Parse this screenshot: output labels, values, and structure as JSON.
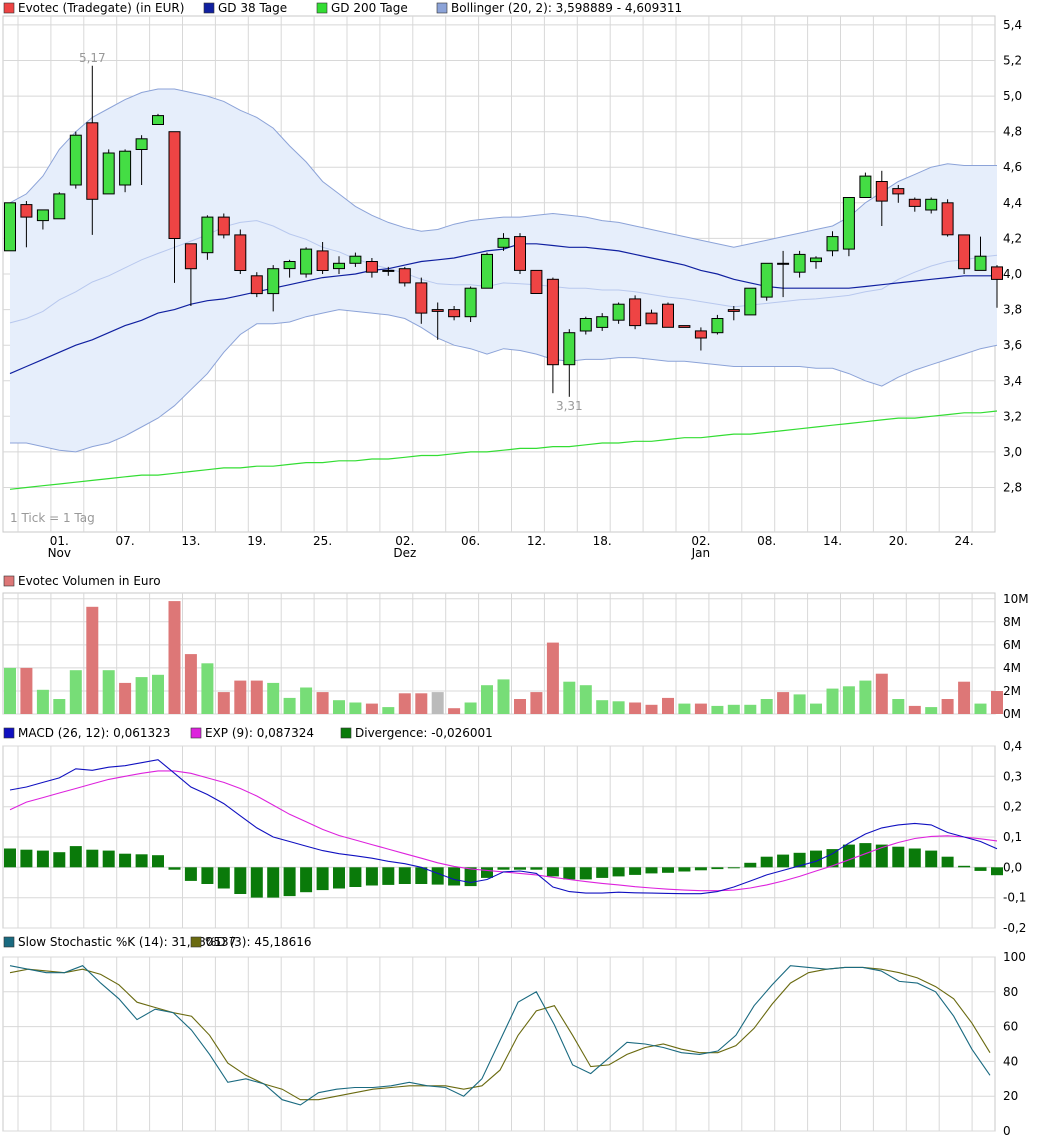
{
  "colors": {
    "up": "#44dd44",
    "down": "#ee4444",
    "neutral": "#bbbbbb",
    "gd38": "#1020a0",
    "gd200": "#33dd33",
    "bollinger": "#8ca3d8",
    "bollinger_fill": "#e6eefb",
    "vol_up": "#77dd77",
    "vol_down": "#dd7777",
    "macd": "#1010c0",
    "exp": "#dd22dd",
    "divergence": "#0a7a0a",
    "stoch_k": "#1a6a80",
    "stoch_d": "#6a6a10",
    "grid": "#d8d8d8",
    "label_grey": "#999999"
  },
  "chart_data": [
    {
      "type": "candlestick",
      "legend": [
        {
          "label": "Evotec (Tradegate) (in EUR)",
          "color": "#ee4444"
        },
        {
          "label": "GD 38 Tage",
          "color": "#1020a0"
        },
        {
          "label": "GD 200 Tage",
          "color": "#33dd33"
        },
        {
          "label": "Bollinger (20, 2): 3,598889 - 4,609311",
          "color": "#8ca3d8"
        }
      ],
      "ylim": [
        2.55,
        5.45
      ],
      "yticks": [
        "2,8",
        "3,0",
        "3,2",
        "3,4",
        "3,6",
        "3,8",
        "4,0",
        "4,2",
        "4,4",
        "4,6",
        "4,8",
        "5,0",
        "5,2",
        "5,4"
      ],
      "xticks": [
        {
          "i": 3,
          "label": "01.",
          "sub": "Nov"
        },
        {
          "i": 7,
          "label": "07.",
          "sub": ""
        },
        {
          "i": 11,
          "label": "13.",
          "sub": ""
        },
        {
          "i": 15,
          "label": "19.",
          "sub": ""
        },
        {
          "i": 19,
          "label": "25.",
          "sub": ""
        },
        {
          "i": 24,
          "label": "02.",
          "sub": "Dez"
        },
        {
          "i": 28,
          "label": "06.",
          "sub": ""
        },
        {
          "i": 32,
          "label": "12.",
          "sub": ""
        },
        {
          "i": 36,
          "label": "18.",
          "sub": ""
        },
        {
          "i": 42,
          "label": "02.",
          "sub": "Jan"
        },
        {
          "i": 46,
          "label": "08.",
          "sub": ""
        },
        {
          "i": 50,
          "label": "14.",
          "sub": ""
        },
        {
          "i": 54,
          "label": "20.",
          "sub": ""
        },
        {
          "i": 58,
          "label": "24.",
          "sub": ""
        }
      ],
      "annotations": [
        {
          "i": 5,
          "value": 5.17,
          "text": "5,17",
          "position": "above"
        },
        {
          "i": 34,
          "value": 3.31,
          "text": "3,31",
          "position": "below"
        }
      ],
      "note": "1 Tick = 1 Tag",
      "candles": [
        [
          4.13,
          4.4,
          4.13,
          4.4
        ],
        [
          4.39,
          4.41,
          4.15,
          4.32
        ],
        [
          4.3,
          4.36,
          4.25,
          4.36
        ],
        [
          4.31,
          4.46,
          4.31,
          4.45
        ],
        [
          4.5,
          4.8,
          4.48,
          4.78
        ],
        [
          4.85,
          5.17,
          4.22,
          4.42
        ],
        [
          4.45,
          4.7,
          4.45,
          4.68
        ],
        [
          4.5,
          4.7,
          4.46,
          4.69
        ],
        [
          4.7,
          4.78,
          4.5,
          4.76
        ],
        [
          4.84,
          4.9,
          4.84,
          4.89
        ],
        [
          4.8,
          4.8,
          3.95,
          4.2
        ],
        [
          4.17,
          4.17,
          3.82,
          4.03
        ],
        [
          4.12,
          4.33,
          4.08,
          4.32
        ],
        [
          4.32,
          4.34,
          4.2,
          4.22
        ],
        [
          4.22,
          4.25,
          4.0,
          4.02
        ],
        [
          3.99,
          4.01,
          3.87,
          3.89
        ],
        [
          3.89,
          4.05,
          3.79,
          4.03
        ],
        [
          4.03,
          4.08,
          3.98,
          4.07
        ],
        [
          4.0,
          4.15,
          3.98,
          4.14
        ],
        [
          4.13,
          4.18,
          4.0,
          4.02
        ],
        [
          4.03,
          4.1,
          4.0,
          4.06
        ],
        [
          4.06,
          4.12,
          4.04,
          4.1
        ],
        [
          4.07,
          4.09,
          3.98,
          4.01
        ],
        [
          4.02,
          4.04,
          3.99,
          4.02
        ],
        [
          4.03,
          4.04,
          3.93,
          3.95
        ],
        [
          3.95,
          3.98,
          3.72,
          3.78
        ],
        [
          3.8,
          3.84,
          3.63,
          3.79
        ],
        [
          3.8,
          3.82,
          3.74,
          3.76
        ],
        [
          3.76,
          3.93,
          3.73,
          3.92
        ],
        [
          3.92,
          4.12,
          3.92,
          4.11
        ],
        [
          4.15,
          4.23,
          4.13,
          4.2
        ],
        [
          4.21,
          4.23,
          4.0,
          4.02
        ],
        [
          4.02,
          4.02,
          3.89,
          3.89
        ],
        [
          3.97,
          3.98,
          3.33,
          3.49
        ],
        [
          3.49,
          3.69,
          3.31,
          3.67
        ],
        [
          3.68,
          3.76,
          3.66,
          3.75
        ],
        [
          3.7,
          3.78,
          3.68,
          3.76
        ],
        [
          3.74,
          3.84,
          3.72,
          3.83
        ],
        [
          3.86,
          3.88,
          3.69,
          3.71
        ],
        [
          3.78,
          3.8,
          3.72,
          3.72
        ],
        [
          3.83,
          3.84,
          3.7,
          3.7
        ],
        [
          3.71,
          3.71,
          3.7,
          3.7
        ],
        [
          3.68,
          3.7,
          3.57,
          3.64
        ],
        [
          3.67,
          3.77,
          3.66,
          3.75
        ],
        [
          3.8,
          3.82,
          3.74,
          3.79
        ],
        [
          3.77,
          3.92,
          3.77,
          3.92
        ],
        [
          3.87,
          4.06,
          3.85,
          4.06
        ],
        [
          4.06,
          4.13,
          3.87,
          4.06
        ],
        [
          4.01,
          4.13,
          3.98,
          4.11
        ],
        [
          4.07,
          4.1,
          4.03,
          4.09
        ],
        [
          4.13,
          4.24,
          4.1,
          4.21
        ],
        [
          4.14,
          4.43,
          4.1,
          4.43
        ],
        [
          4.43,
          4.57,
          4.43,
          4.55
        ],
        [
          4.52,
          4.58,
          4.27,
          4.41
        ],
        [
          4.48,
          4.5,
          4.4,
          4.45
        ],
        [
          4.42,
          4.43,
          4.35,
          4.38
        ],
        [
          4.36,
          4.43,
          4.34,
          4.42
        ],
        [
          4.4,
          4.42,
          4.21,
          4.22
        ],
        [
          4.22,
          4.22,
          4.0,
          4.03
        ],
        [
          4.02,
          4.21,
          4.02,
          4.1
        ],
        [
          4.04,
          4.05,
          3.81,
          3.97
        ]
      ],
      "gd38": [
        3.44,
        3.48,
        3.52,
        3.56,
        3.6,
        3.63,
        3.67,
        3.71,
        3.74,
        3.78,
        3.8,
        3.83,
        3.85,
        3.86,
        3.88,
        3.9,
        3.92,
        3.94,
        3.96,
        3.98,
        3.99,
        4.0,
        4.02,
        4.03,
        4.05,
        4.07,
        4.08,
        4.09,
        4.11,
        4.13,
        4.14,
        4.17,
        4.17,
        4.16,
        4.15,
        4.15,
        4.14,
        4.13,
        4.11,
        4.09,
        4.07,
        4.05,
        4.02,
        4.0,
        3.97,
        3.95,
        3.93,
        3.92,
        3.92,
        3.92,
        3.92,
        3.92,
        3.93,
        3.94,
        3.95,
        3.96,
        3.97,
        3.98,
        3.99,
        3.99,
        3.99
      ],
      "gd200": [
        2.79,
        2.8,
        2.81,
        2.82,
        2.83,
        2.84,
        2.85,
        2.86,
        2.87,
        2.87,
        2.88,
        2.89,
        2.9,
        2.91,
        2.91,
        2.92,
        2.92,
        2.93,
        2.94,
        2.94,
        2.95,
        2.95,
        2.96,
        2.96,
        2.97,
        2.98,
        2.98,
        2.99,
        3.0,
        3.0,
        3.01,
        3.02,
        3.02,
        3.03,
        3.03,
        3.04,
        3.05,
        3.05,
        3.06,
        3.06,
        3.07,
        3.08,
        3.08,
        3.09,
        3.1,
        3.1,
        3.11,
        3.12,
        3.13,
        3.14,
        3.15,
        3.16,
        3.17,
        3.18,
        3.19,
        3.19,
        3.2,
        3.21,
        3.22,
        3.22,
        3.23
      ],
      "bollinger_upper": [
        4.4,
        4.45,
        4.55,
        4.7,
        4.8,
        4.88,
        4.93,
        4.98,
        5.02,
        5.04,
        5.04,
        5.02,
        5.0,
        4.97,
        4.92,
        4.88,
        4.82,
        4.72,
        4.63,
        4.52,
        4.45,
        4.38,
        4.33,
        4.29,
        4.26,
        4.24,
        4.25,
        4.28,
        4.3,
        4.31,
        4.32,
        4.32,
        4.33,
        4.34,
        4.33,
        4.32,
        4.3,
        4.29,
        4.27,
        4.25,
        4.23,
        4.21,
        4.19,
        4.17,
        4.15,
        4.17,
        4.19,
        4.21,
        4.23,
        4.25,
        4.27,
        4.32,
        4.4,
        4.46,
        4.52,
        4.56,
        4.6,
        4.62,
        4.61,
        4.61,
        4.61
      ],
      "bollinger_lower": [
        3.05,
        3.05,
        3.03,
        3.01,
        3.0,
        3.03,
        3.05,
        3.09,
        3.14,
        3.19,
        3.26,
        3.35,
        3.44,
        3.56,
        3.66,
        3.72,
        3.72,
        3.73,
        3.76,
        3.78,
        3.8,
        3.79,
        3.78,
        3.77,
        3.75,
        3.7,
        3.64,
        3.6,
        3.58,
        3.55,
        3.58,
        3.57,
        3.55,
        3.52,
        3.51,
        3.52,
        3.52,
        3.53,
        3.53,
        3.52,
        3.51,
        3.51,
        3.5,
        3.49,
        3.48,
        3.48,
        3.48,
        3.48,
        3.48,
        3.47,
        3.47,
        3.44,
        3.4,
        3.37,
        3.42,
        3.46,
        3.49,
        3.52,
        3.55,
        3.58,
        3.6
      ]
    },
    {
      "type": "bar",
      "legend": [
        {
          "label": "Evotec Volumen in Euro",
          "color": "#dd7777"
        }
      ],
      "ylim": [
        0,
        10500000
      ],
      "ytick_values": [
        0,
        2000000,
        4000000,
        6000000,
        8000000,
        10000000
      ],
      "ytick_labels": [
        "0M",
        "2M",
        "4M",
        "6M",
        "8M",
        "10M"
      ],
      "values": [
        4000000,
        4000000,
        2100000,
        1300000,
        3800000,
        9300000,
        3800000,
        2700000,
        3200000,
        3400000,
        9800000,
        5200000,
        4400000,
        1900000,
        2900000,
        2900000,
        2700000,
        1400000,
        2300000,
        1900000,
        1200000,
        1000000,
        900000,
        600000,
        1800000,
        1800000,
        1900000,
        500000,
        1000000,
        2500000,
        3000000,
        1300000,
        1900000,
        6200000,
        2800000,
        2500000,
        1200000,
        1100000,
        1000000,
        800000,
        1400000,
        900000,
        900000,
        700000,
        800000,
        800000,
        1300000,
        1900000,
        1700000,
        900000,
        2200000,
        2400000,
        2900000,
        3500000,
        1300000,
        700000,
        600000,
        1300000,
        2800000,
        900000,
        2000000
      ],
      "direction": [
        "up",
        "down",
        "up",
        "up",
        "up",
        "down",
        "up",
        "down",
        "up",
        "up",
        "down",
        "down",
        "up",
        "down",
        "down",
        "down",
        "up",
        "up",
        "up",
        "down",
        "up",
        "up",
        "down",
        "up",
        "down",
        "down",
        "neutral",
        "down",
        "up",
        "up",
        "up",
        "down",
        "down",
        "down",
        "up",
        "up",
        "up",
        "up",
        "down",
        "down",
        "down",
        "up",
        "down",
        "up",
        "up",
        "up",
        "up",
        "down",
        "up",
        "up",
        "up",
        "up",
        "up",
        "down",
        "up",
        "down",
        "up",
        "down",
        "down",
        "up",
        "down"
      ]
    },
    {
      "type": "line+bar",
      "legend": [
        {
          "label": "MACD (26, 12): 0,061323",
          "color": "#1010c0"
        },
        {
          "label": "EXP (9): 0,087324",
          "color": "#dd22dd"
        },
        {
          "label": "Divergence: -0,026001",
          "color": "#0a7a0a"
        }
      ],
      "ylim": [
        -0.2,
        0.4
      ],
      "yticks": [
        {
          "v": 0.4,
          "t": "0,4"
        },
        {
          "v": 0.3,
          "t": "0,3"
        },
        {
          "v": 0.2,
          "t": "0,2"
        },
        {
          "v": 0.1,
          "t": "0,1"
        },
        {
          "v": 0.0,
          "t": "0,0"
        },
        {
          "v": -0.1,
          "t": "-0,1"
        },
        {
          "v": -0.2,
          "t": "-0,2"
        }
      ],
      "macd": [
        0.255,
        0.265,
        0.28,
        0.295,
        0.325,
        0.32,
        0.33,
        0.335,
        0.345,
        0.355,
        0.31,
        0.265,
        0.24,
        0.21,
        0.17,
        0.13,
        0.1,
        0.085,
        0.07,
        0.055,
        0.045,
        0.038,
        0.03,
        0.02,
        0.012,
        0.0,
        -0.02,
        -0.04,
        -0.05,
        -0.04,
        -0.015,
        -0.012,
        -0.02,
        -0.065,
        -0.08,
        -0.085,
        -0.085,
        -0.082,
        -0.084,
        -0.085,
        -0.086,
        -0.087,
        -0.087,
        -0.08,
        -0.065,
        -0.045,
        -0.025,
        -0.01,
        0.005,
        0.02,
        0.045,
        0.08,
        0.11,
        0.13,
        0.14,
        0.145,
        0.14,
        0.115,
        0.1,
        0.085,
        0.061
      ],
      "exp": [
        0.19,
        0.215,
        0.23,
        0.245,
        0.26,
        0.275,
        0.29,
        0.3,
        0.31,
        0.318,
        0.318,
        0.31,
        0.295,
        0.28,
        0.26,
        0.235,
        0.205,
        0.175,
        0.15,
        0.125,
        0.105,
        0.09,
        0.075,
        0.06,
        0.045,
        0.03,
        0.015,
        0.003,
        -0.005,
        -0.01,
        -0.015,
        -0.02,
        -0.025,
        -0.033,
        -0.04,
        -0.047,
        -0.053,
        -0.058,
        -0.064,
        -0.068,
        -0.072,
        -0.075,
        -0.077,
        -0.077,
        -0.075,
        -0.068,
        -0.058,
        -0.045,
        -0.03,
        -0.012,
        0.005,
        0.025,
        0.045,
        0.065,
        0.082,
        0.095,
        0.102,
        0.104,
        0.1,
        0.094,
        0.087
      ],
      "divergence": [
        0.062,
        0.058,
        0.055,
        0.05,
        0.07,
        0.058,
        0.055,
        0.045,
        0.043,
        0.04,
        -0.008,
        -0.045,
        -0.055,
        -0.07,
        -0.088,
        -0.1,
        -0.1,
        -0.095,
        -0.082,
        -0.075,
        -0.07,
        -0.065,
        -0.06,
        -0.058,
        -0.055,
        -0.055,
        -0.057,
        -0.06,
        -0.062,
        -0.035,
        -0.008,
        -0.008,
        -0.008,
        -0.03,
        -0.04,
        -0.04,
        -0.035,
        -0.03,
        -0.025,
        -0.02,
        -0.018,
        -0.014,
        -0.01,
        -0.006,
        0.0,
        0.015,
        0.035,
        0.042,
        0.048,
        0.055,
        0.06,
        0.075,
        0.08,
        0.075,
        0.068,
        0.062,
        0.055,
        0.035,
        0.005,
        -0.012,
        -0.026
      ]
    },
    {
      "type": "line",
      "legend": [
        {
          "label": "Slow Stochastic %K (14): 31,980537",
          "color": "#1a6a80"
        },
        {
          "label": "%D (3): 45,18616",
          "color": "#6a6a10"
        }
      ],
      "ylim": [
        0,
        100
      ],
      "yticks": [
        {
          "v": 100,
          "t": "100"
        },
        {
          "v": 80,
          "t": "80"
        },
        {
          "v": 60,
          "t": "60"
        },
        {
          "v": 40,
          "t": "40"
        },
        {
          "v": 20,
          "t": "20"
        },
        {
          "v": 0,
          "t": "0"
        }
      ],
      "k": [
        95,
        93,
        91,
        91,
        95,
        85,
        76,
        64,
        70,
        68,
        58,
        44,
        28,
        30,
        27,
        18,
        15,
        22,
        24,
        25,
        25,
        26,
        28,
        26,
        25,
        20,
        30,
        52,
        74,
        80,
        61,
        38,
        33,
        42,
        51,
        50,
        48,
        45,
        44,
        46,
        55,
        72,
        84,
        95,
        94,
        93,
        94,
        94,
        92,
        86,
        85,
        80,
        66,
        47,
        32
      ],
      "d": [
        91,
        93,
        92,
        91,
        93,
        90,
        84,
        74,
        71,
        68,
        66,
        55,
        39,
        32,
        27,
        24,
        18,
        18,
        20,
        22,
        24,
        25,
        26,
        26,
        26,
        24,
        26,
        35,
        55,
        69,
        72,
        55,
        37,
        38,
        44,
        48,
        50,
        47,
        45,
        45,
        49,
        59,
        73,
        85,
        91,
        93,
        94,
        94,
        93,
        91,
        88,
        83,
        76,
        62,
        45
      ]
    }
  ]
}
